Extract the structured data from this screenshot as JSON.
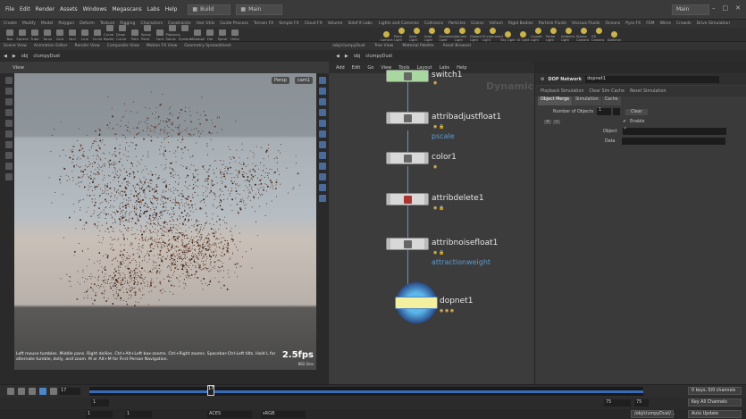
{
  "menubar": {
    "items": [
      "File",
      "Edit",
      "Render",
      "Assets",
      "Windows",
      "Megascans",
      "Labs",
      "Help"
    ],
    "desktop": "Build",
    "workspace": "Main",
    "right_workspace": "Main"
  },
  "shelf": {
    "tabs_left": [
      "Create",
      "Modify",
      "Model",
      "Polygon",
      "Deform",
      "Texture",
      "Rigging",
      "Characters",
      "Constraints",
      "Hair Utils",
      "Guide Process",
      "Terrain FX",
      "Simple FX",
      "Cloud FX",
      "Volume",
      "SideFX Labs"
    ],
    "tabs_right": [
      "Lights and Cameras",
      "Collisions",
      "Particles",
      "Grains",
      "Vellum",
      "Rigid Bodies",
      "Particle Fluids",
      "Viscous Fluids",
      "Oceans",
      "Pyro FX",
      "FEM",
      "Wires",
      "Crowds",
      "Drive Simulation"
    ],
    "tools_left": [
      "Box",
      "Sphere",
      "Tube",
      "Torus",
      "Grid",
      "Null",
      "Line",
      "Circle",
      "Curve Bezier",
      "Draw Curve",
      "Path",
      "Spray Paint",
      "Font",
      "Platonic Solids",
      "L-System",
      "Metaball",
      "File",
      "Spiral",
      "Helix"
    ],
    "tools_right": [
      "Camera",
      "Point Light",
      "Spot Light",
      "Area Light",
      "Geometry Light",
      "Volume Light",
      "Distant Light",
      "Environment Light",
      "Sky Light",
      "GI Light",
      "Caustic Light",
      "Portal Light",
      "Ambient Light",
      "Stereo Camera",
      "VR Camera",
      "Switcher"
    ]
  },
  "left_pane": {
    "tabs": [
      "Scene View",
      "Animation Editor",
      "Render View",
      "Composite View",
      "Motion FX View",
      "Geometry Spreadsheet"
    ],
    "path": [
      "obj",
      "clumpyDust"
    ],
    "view_title": "View",
    "persp": "Persp",
    "cam": "cam1",
    "hint": "Left mouse tumbles. Middle pans. Right dollies. Ctrl+Alt+Left box-zooms. Ctrl+Right zooms. Spacebar-Ctrl-Left tilts. Hold L for alternate tumble, dolly, and zoom.    M or Alt+M for First Person Navigation.",
    "fps": "2.5fps",
    "fps_sub": "892.5ms"
  },
  "right_pane": {
    "tabs": [
      "/obj/clumpyDust",
      "Tree View",
      "Material Palette",
      "Asset Browser"
    ],
    "path": [
      "obj",
      "clumpyDust"
    ],
    "menu": [
      "Add",
      "Edit",
      "Go",
      "View",
      "Tools",
      "Layout",
      "Labs",
      "Help"
    ],
    "network_label": "Dynamics",
    "nodes": [
      {
        "name": "switch1",
        "sub": ""
      },
      {
        "name": "attribadjustfloat1",
        "sub": "pscale"
      },
      {
        "name": "color1",
        "sub": ""
      },
      {
        "name": "attribdelete1",
        "sub": ""
      },
      {
        "name": "attribnoisefloat1",
        "sub": "attractionweight"
      },
      {
        "name": "dopnet1",
        "sub": ""
      }
    ]
  },
  "params": {
    "type": "DOP Network",
    "name": "dopnet1",
    "row2": [
      "Playback Simulation",
      "Clear Sim Cache",
      "Reset Simulation"
    ],
    "tabs": [
      "Object Merge",
      "Simulation",
      "Cache"
    ],
    "num_objects_label": "Number of Objects",
    "num_objects": "1",
    "clear": "Clear",
    "enable": "Enable",
    "object_label": "Object",
    "data_label": "Data",
    "object_value": "*"
  },
  "timeline": {
    "frame": "17",
    "start": "1",
    "end": "1",
    "marker": "17",
    "range_start": "1",
    "range_end": "75",
    "range_end2": "75",
    "colorspace": "ACES",
    "colorspace2": "sRGB",
    "keys": "0 keys, 0/0 channels",
    "key_all": "Key All Channels",
    "auto_update": "Auto Update",
    "path": "/obj/clumpyDust/..."
  }
}
